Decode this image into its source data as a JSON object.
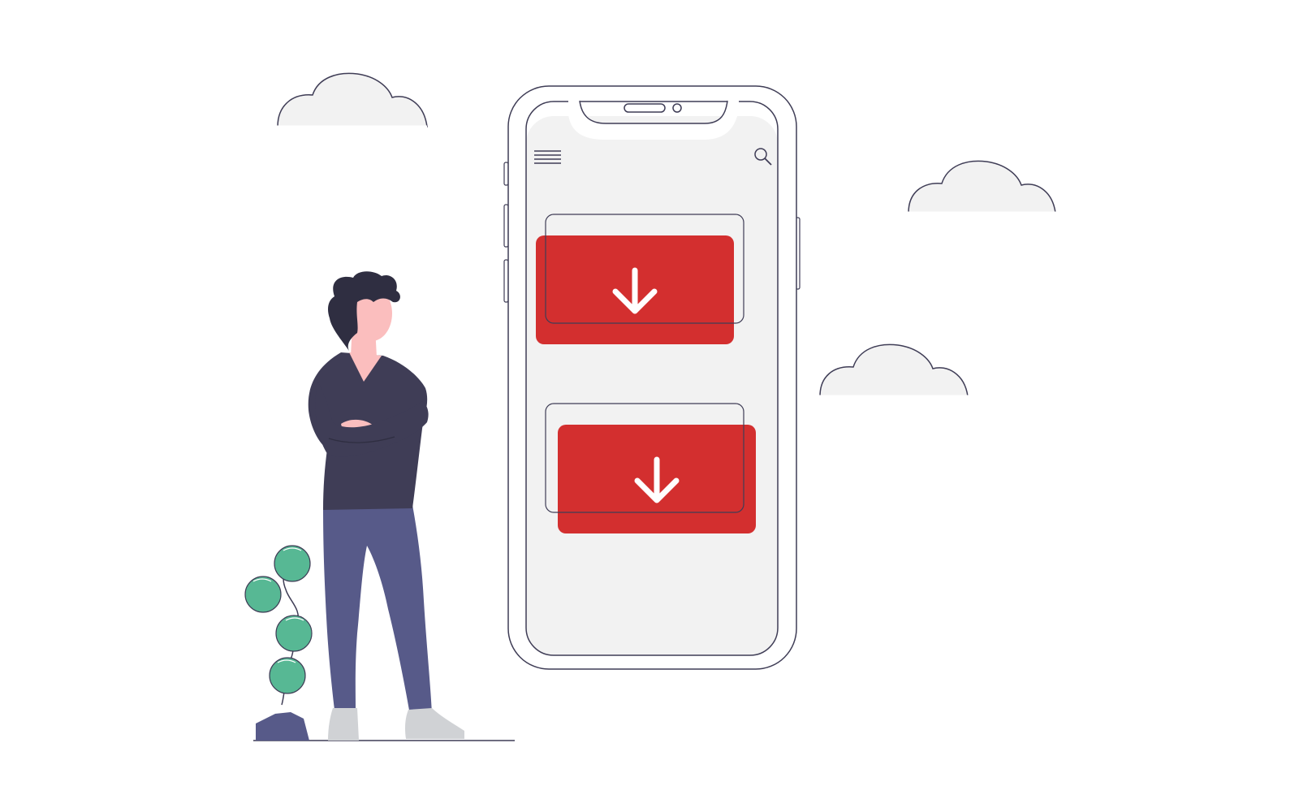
{
  "colors": {
    "background": "#ffffff",
    "outline": "#3f3d56",
    "screen": "#f2f2f2",
    "cloud_fill": "#f2f2f2",
    "accent_red": "#d32f2f",
    "shirt": "#3f3d56",
    "pants": "#575a89",
    "skin": "#fbbebe",
    "hair": "#2f2e41",
    "shoes": "#d0d2d5",
    "plant_green": "#57b894",
    "stone": "#575a89",
    "arrow": "#ffffff"
  },
  "icons": {
    "menu": "hamburger-menu-icon",
    "search": "search-icon",
    "download": "download-arrow-icon"
  },
  "phone": {
    "download_cards": 2
  }
}
